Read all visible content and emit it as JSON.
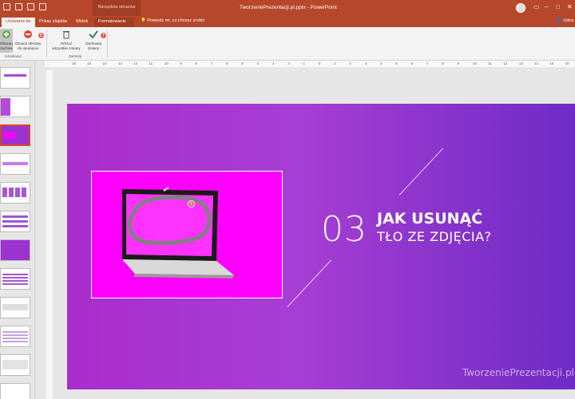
{
  "titlebar": {
    "context_group": "Narzędzia obrazów",
    "doc_title": "TworzeniePrezentacji.pl.pptx  -  PowerPoint",
    "avatar_initials": "JD"
  },
  "tabs": [
    {
      "label": "Usuwanie tła"
    },
    {
      "label": "Pokaz slajdów"
    },
    {
      "label": "Widok"
    },
    {
      "label": "Formatowanie"
    }
  ],
  "tellme": "Powiedz mi, co chcesz zrobić",
  "share": "Udos",
  "ribbon": {
    "btn_mark_keep": "Obszary\nzachowania",
    "btn_mark_remove": "Oznacz obszary\ndo usunięcia",
    "btn_discard": "Odrzuć\nwszystkie zmiany",
    "btn_keep": "Zachowaj\nzmiany",
    "group_refine": "Uściślanie",
    "group_close": "Zamknij",
    "badge_remove": "5",
    "badge_keep": "7"
  },
  "ruler_ticks": [
    "16",
    "15",
    "14",
    "13",
    "12",
    "11",
    "10",
    "9",
    "8",
    "7",
    "6",
    "5",
    "4",
    "3",
    "2",
    "1",
    "0",
    "1",
    "2",
    "3",
    "4",
    "5",
    "6",
    "7",
    "8",
    "9",
    "10",
    "11",
    "12",
    "13",
    "14",
    "15",
    "16"
  ],
  "slide": {
    "number": "03",
    "title_line1": "JAK USUNĄĆ",
    "title_line2": "TŁO ZE ZDJĘCIA?",
    "watermark": "TworzeniePrezentacji.pl",
    "badge": "6"
  },
  "colors": {
    "accent": "#b7472a",
    "photo_bg": "#ff00ff",
    "slide_left": "#a82dcc",
    "slide_right": "#6e2bc4"
  }
}
